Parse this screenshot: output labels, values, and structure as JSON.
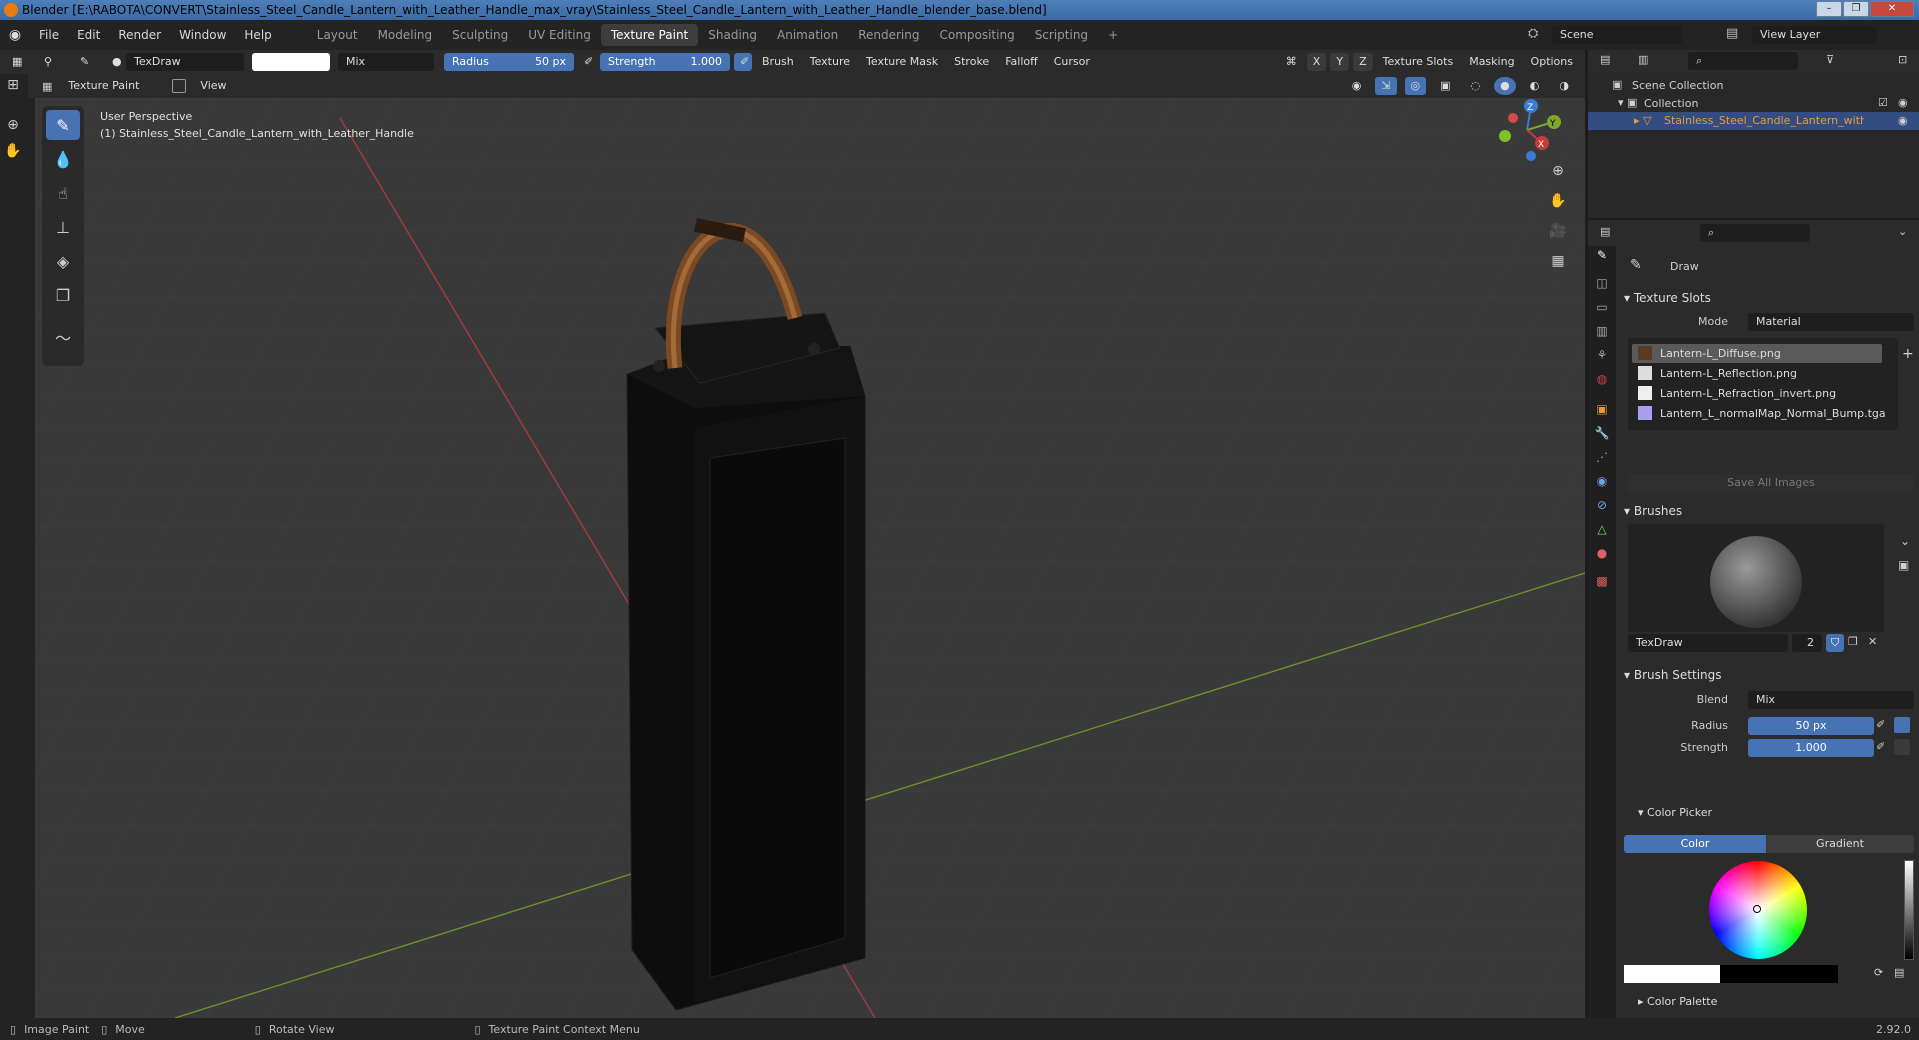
{
  "window": {
    "title": "Blender [E:\\RABOTA\\CONVERT\\Stainless_Steel_Candle_Lantern_with_Leather_Handle_max_vray\\Stainless_Steel_Candle_Lantern_with_Leather_Handle_blender_base.blend]"
  },
  "menu": [
    "File",
    "Edit",
    "Render",
    "Window",
    "Help"
  ],
  "workspaces": [
    "Layout",
    "Modeling",
    "Sculpting",
    "UV Editing",
    "Texture Paint",
    "Shading",
    "Animation",
    "Rendering",
    "Compositing",
    "Scripting"
  ],
  "active_workspace": "Texture Paint",
  "scene": {
    "label": "Scene",
    "view_layer": "View Layer"
  },
  "tool_header": {
    "brush_name": "TexDraw",
    "blend": "Mix",
    "radius_label": "Radius",
    "radius_value": "50 px",
    "strength_label": "Strength",
    "strength_value": "1.000",
    "menus": [
      "Brush",
      "Texture",
      "Texture Mask",
      "Stroke",
      "Falloff",
      "Cursor"
    ],
    "axes": [
      "X",
      "Y",
      "Z"
    ],
    "right_menus": [
      "Texture Slots",
      "Masking",
      "Options"
    ]
  },
  "editor_header": {
    "mode": "Texture Paint",
    "view": "View"
  },
  "viewport": {
    "line1": "User Perspective",
    "line2": "(1) Stainless_Steel_Candle_Lantern_with_Leather_Handle",
    "gizmo": {
      "z": "Z",
      "y": "Y",
      "x": "X"
    }
  },
  "outliner": {
    "scene_collection": "Scene Collection",
    "collection": "Collection",
    "object": "Stainless_Steel_Candle_Lantern_with_Le"
  },
  "properties": {
    "tool_name": "Draw",
    "texture_slots_title": "Texture Slots",
    "mode_label": "Mode",
    "mode_value": "Material",
    "slots": [
      "Lantern-L_Diffuse.png",
      "Lantern-L_Reflection.png",
      "Lantern-L_Refraction_invert.png",
      "Lantern_L_normalMap_Normal_Bump.tga"
    ],
    "save_all": "Save All Images",
    "brushes_title": "Brushes",
    "brush_name": "TexDraw",
    "brush_users": "2",
    "brush_settings_title": "Brush Settings",
    "blend_label": "Blend",
    "blend_value": "Mix",
    "radius_label": "Radius",
    "radius_value": "50 px",
    "strength_label": "Strength",
    "strength_value": "1.000",
    "color_picker_title": "Color Picker",
    "color_tab": "Color",
    "gradient_tab": "Gradient",
    "color_palette_title": "Color Palette"
  },
  "status": {
    "item1": "Image Paint",
    "item2": "Move",
    "item3": "Rotate View",
    "item4": "Texture Paint Context Menu",
    "version": "2.92.0"
  },
  "colors": {
    "accent": "#4772b3",
    "x_axis": "#c73a3a",
    "y_axis": "#7ea82a",
    "z_axis": "#3b7bd6"
  }
}
